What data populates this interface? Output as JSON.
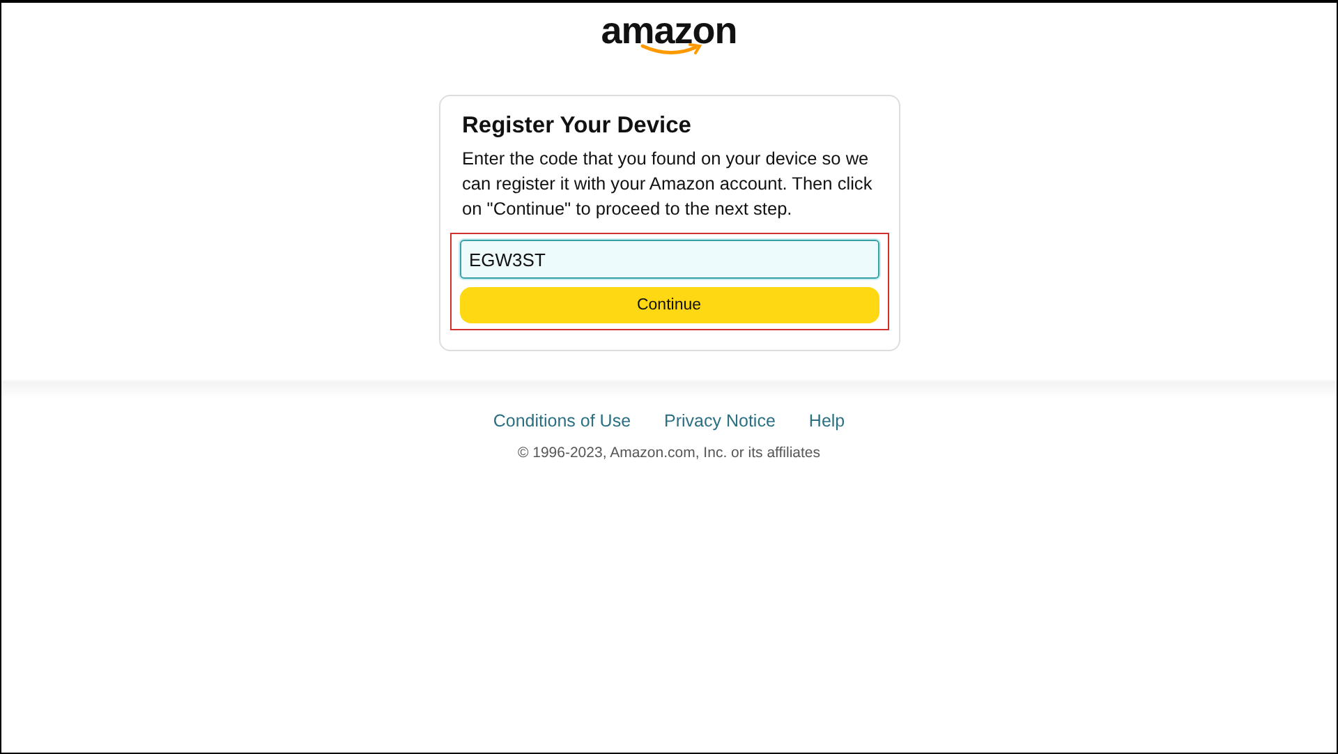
{
  "logo": {
    "text": "amazon"
  },
  "card": {
    "title": "Register Your Device",
    "description": "Enter the code that you found on your device so we can register it with your Amazon account. Then click on \"Continue\" to proceed to the next step.",
    "code_field": {
      "value": "EGW3ST"
    },
    "continue_button": "Continue",
    "highlighted": true
  },
  "footer": {
    "links": [
      "Conditions of Use",
      "Privacy Notice",
      "Help"
    ],
    "copyright": "© 1996-2023, Amazon.com, Inc. or its affiliates"
  }
}
